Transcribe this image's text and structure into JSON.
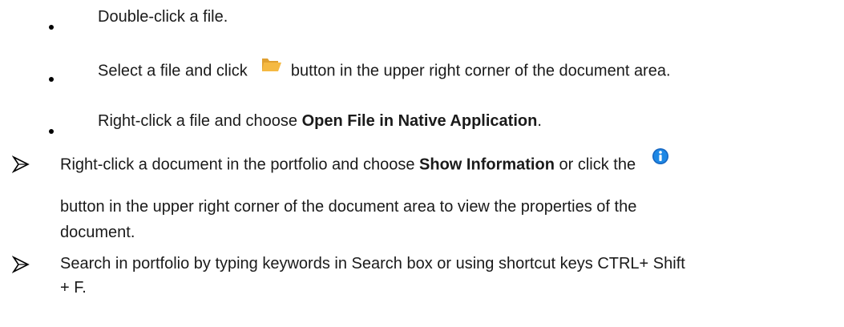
{
  "sub_items": [
    {
      "text": "Double-click a file."
    },
    {
      "before": "Select a file and click",
      "after": "button in the upper right corner of the document area."
    },
    {
      "before": "Right-click a file and choose ",
      "bold": "Open File in Native Application",
      "after": "."
    }
  ],
  "item_show_info": {
    "before": "Right-click a document in the portfolio and choose ",
    "bold": "Show Information",
    "middle": " or click the",
    "line2": "button in the upper right corner of the document area to view the properties of the",
    "line3": "document."
  },
  "item_search": {
    "line1": "Search in portfolio by typing keywords in Search box or using shortcut keys CTRL+ Shift",
    "line2": "+ F."
  },
  "icons": {
    "folder": "folder-open-icon",
    "info": "info-icon",
    "folder_color": "#F5B942",
    "info_color": "#1565C0"
  }
}
